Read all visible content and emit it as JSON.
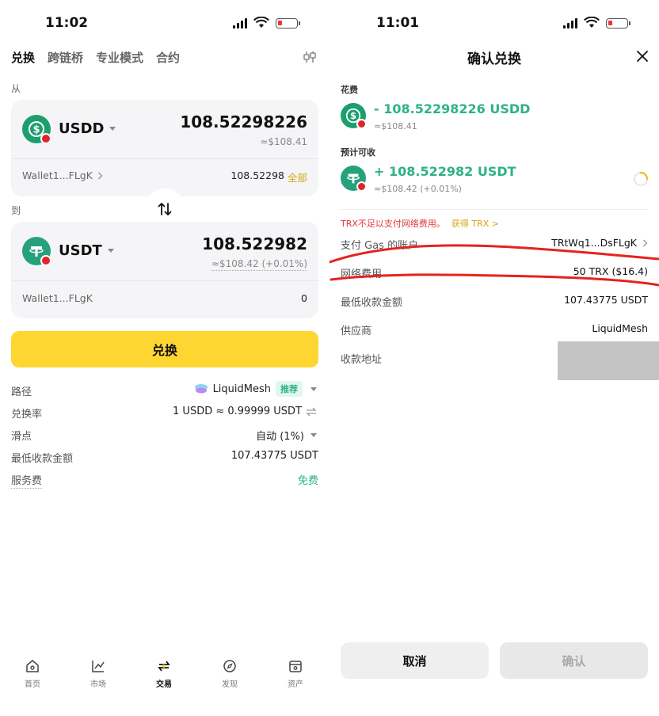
{
  "left": {
    "status": {
      "time": "11:02"
    },
    "tabs": [
      {
        "label": "兑换"
      },
      {
        "label": "跨链桥"
      },
      {
        "label": "专业模式"
      },
      {
        "label": "合约"
      }
    ],
    "from": {
      "label": "从",
      "token": "USDD",
      "amount": "108.52298226",
      "usd": "≈$108.41",
      "wallet": "Wallet1...FLgK",
      "balance": "108.52298",
      "max_label": "全部"
    },
    "to": {
      "label": "到",
      "token": "USDT",
      "amount": "108.522982",
      "usd": "≈$108.42 (+0.01%)",
      "wallet": "Wallet1...FLgK",
      "balance": "0"
    },
    "swap_button": "兑换",
    "info": {
      "route_label": "路径",
      "route_value": "LiquidMesh",
      "route_badge": "推荐",
      "rate_label": "兑换率",
      "rate_value": "1 USDD ≈ 0.99999 USDT",
      "slippage_label": "滑点",
      "slippage_value": "自动 (1%)",
      "min_label": "最低收款金额",
      "min_value": "107.43775 USDT",
      "fee_label": "服务费",
      "fee_value": "免费"
    },
    "nav": [
      {
        "label": "首页"
      },
      {
        "label": "市场"
      },
      {
        "label": "交易"
      },
      {
        "label": "发现"
      },
      {
        "label": "资产"
      }
    ]
  },
  "right": {
    "status": {
      "time": "11:01"
    },
    "title": "确认兑换",
    "spend_label": "花费",
    "spend_amount": "- 108.52298226 USDD",
    "spend_usd": "≈$108.41",
    "receive_label": "预计可收",
    "receive_amount": "+ 108.522982 USDT",
    "receive_usd": "≈$108.42 (+0.01%)",
    "warning": "TRX不足以支付网络费用。",
    "get_trx": "获得 TRX >",
    "gas_label": "支付 Gas 的账户",
    "gas_value": "TRtWq1...DsFLgK",
    "network_fee_label": "网络费用",
    "network_fee_value": "50 TRX ($16.4)",
    "min_label": "最低收款金额",
    "min_value": "107.43775 USDT",
    "provider_label": "供应商",
    "provider_value": "LiquidMesh",
    "address_label": "收款地址",
    "cancel": "取消",
    "confirm": "确认"
  },
  "colors": {
    "accent_yellow": "#fdd631",
    "green": "#2db383",
    "warning_red": "#e0393e",
    "link_gold": "#d7a415",
    "annotation_red": "#e5231d"
  },
  "icons": [
    "signal-icon",
    "wifi-icon",
    "battery-icon",
    "settings-icon",
    "caret-down-icon",
    "chevron-right-icon",
    "swap-arrows-icon",
    "exchange-icon",
    "home-icon",
    "market-icon",
    "trade-icon",
    "discover-icon",
    "assets-icon",
    "close-icon",
    "loading-icon"
  ]
}
